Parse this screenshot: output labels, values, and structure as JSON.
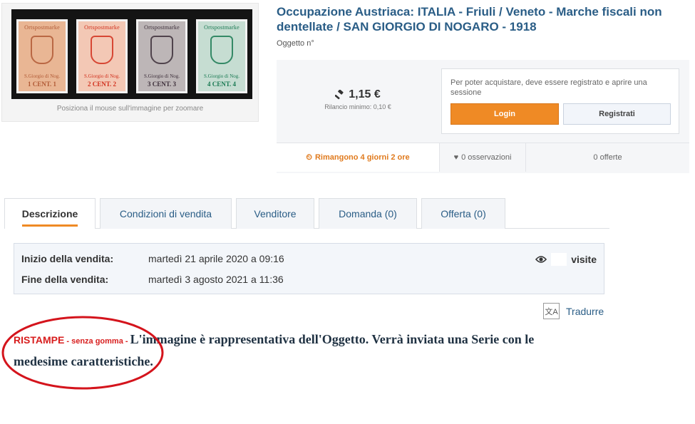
{
  "image": {
    "caption": "Posiziona il mouse sull'immagine per zoomare",
    "stamps": [
      {
        "top": "Ortspostmarke",
        "place": "S.Giorgio di Nog.",
        "value": "1 CENT. 1",
        "color": "#e9b694"
      },
      {
        "top": "Ortspostmarke",
        "place": "S.Giorgio di Nog.",
        "value": "2 CENT. 2",
        "color": "#f3c8b5"
      },
      {
        "top": "Ortspostmarke",
        "place": "S.Giorgio di Nog.",
        "value": "3 CENT. 3",
        "color": "#bdb6b7"
      },
      {
        "top": "Ortspostmarke",
        "place": "S.Giorgio di Nog.",
        "value": "4 CENT. 4",
        "color": "#c6ddd2"
      }
    ]
  },
  "header": {
    "title": "Occupazione Austriaca: ITALIA - Friuli / Veneto - Marche fiscali non dentellate / SAN GIORGIO DI NOGARO - 1918",
    "lot_label": "Oggetto n°"
  },
  "auction": {
    "price": "1,15 €",
    "min_offer": "Rilancio minimo: 0,10 €",
    "login_message": "Per poter acquistare, deve essere registrato e aprire una sessione",
    "login_label": "Login",
    "register_label": "Registrati",
    "time_left": "Rimangono 4 giorni 2 ore",
    "observations": "0 osservazioni",
    "offers": "0 offerte",
    "accent_color": "#ef8a25"
  },
  "tabs": [
    {
      "label": "Descrizione",
      "active": true
    },
    {
      "label": "Condizioni di vendita"
    },
    {
      "label": "Venditore"
    },
    {
      "label": "Domanda (0)"
    },
    {
      "label": "Offerta (0)"
    }
  ],
  "dates": {
    "start_label": "Inizio della vendita:",
    "start_value": "martedì 21 aprile 2020 a 09:16",
    "end_label": "Fine della vendita:",
    "end_value": "martedì 3 agosto 2021 a 11:36",
    "visits_label": "visite"
  },
  "translate_label": "Tradurre",
  "description": {
    "ristampe": "RISTAMPE",
    "gomma": " - senza gomma - ",
    "text": "L'immagine è rappresentativa dell'Oggetto. Verrà inviata una Serie con le medesime caratteristiche."
  }
}
